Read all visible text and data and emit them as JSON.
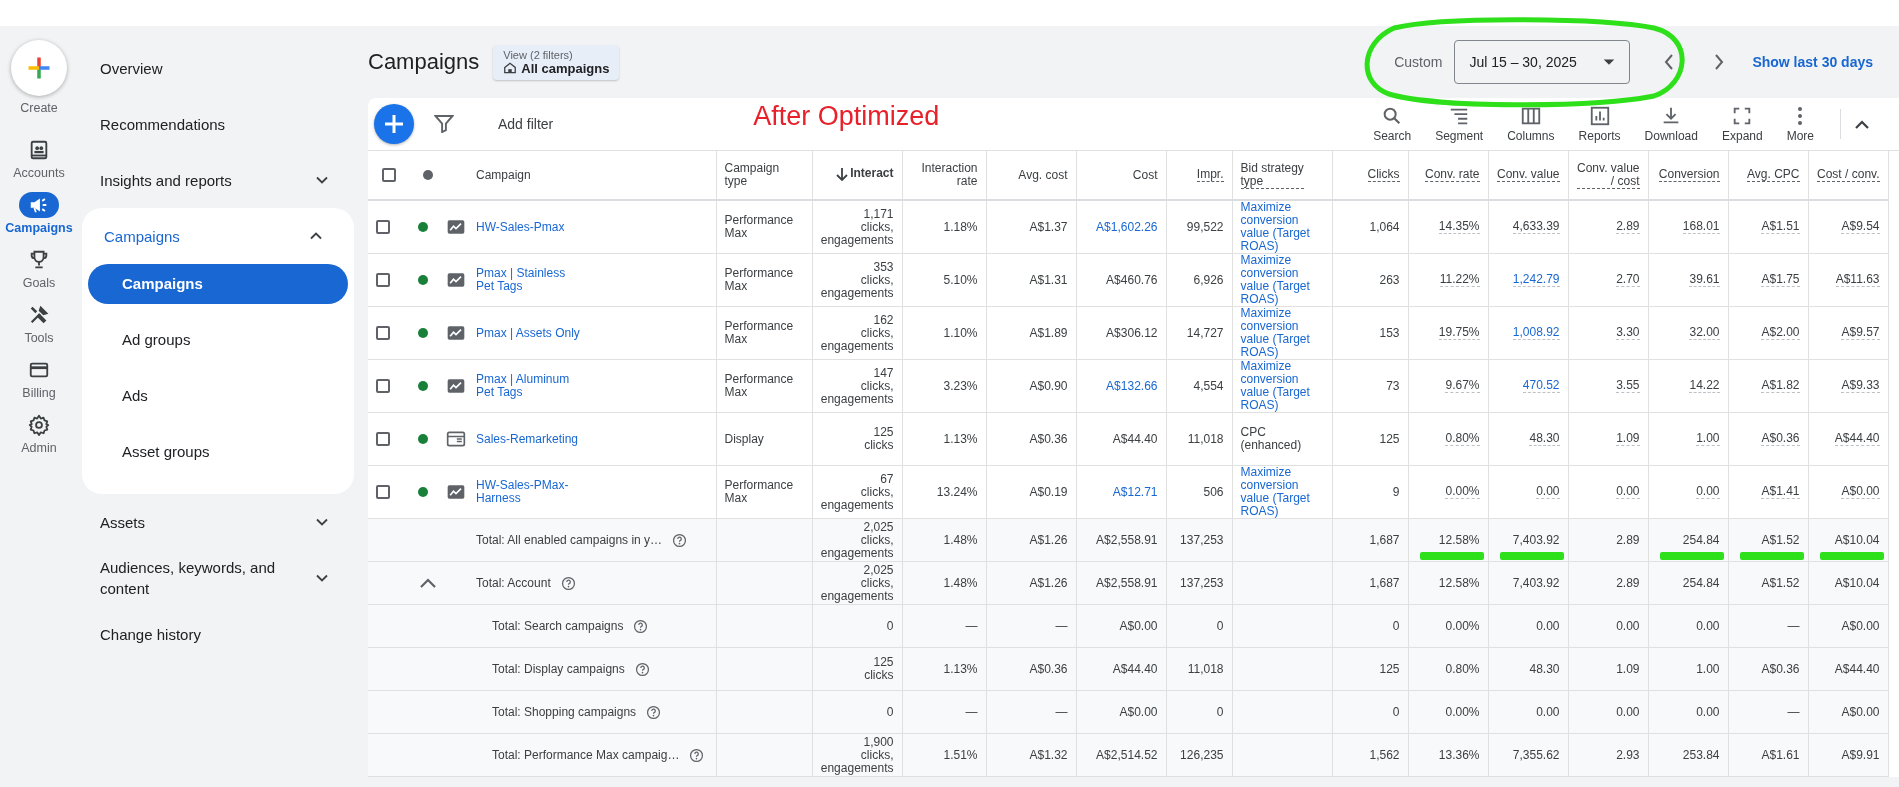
{
  "rail": [
    {
      "label": "Create",
      "kind": "create",
      "selected": false
    },
    {
      "label": "Accounts",
      "kind": "accounts",
      "selected": false
    },
    {
      "label": "Campaigns",
      "kind": "campaigns",
      "selected": true
    },
    {
      "label": "Goals",
      "kind": "goals",
      "selected": false
    },
    {
      "label": "Tools",
      "kind": "tools",
      "selected": false
    },
    {
      "label": "Billing",
      "kind": "billing",
      "selected": false
    },
    {
      "label": "Admin",
      "kind": "admin",
      "selected": false
    }
  ],
  "nav": [
    {
      "label": "Overview"
    },
    {
      "label": "Recommendations"
    },
    {
      "label": "Insights and reports",
      "expanded": false
    },
    {
      "label": "Campaigns",
      "expanded": true,
      "children": [
        {
          "label": "Campaigns",
          "selected": true
        },
        {
          "label": "Ad groups",
          "selected": false
        },
        {
          "label": "Ads",
          "selected": false
        },
        {
          "label": "Asset groups",
          "selected": false
        }
      ]
    },
    {
      "label": "Assets",
      "expanded": false
    },
    {
      "label": "Audiences, keywords, and content",
      "expanded": false
    },
    {
      "label": "Change history"
    }
  ],
  "header": {
    "title": "Campaigns",
    "view": {
      "label": "View (2 filters)",
      "value": "All campaigns"
    },
    "date": {
      "label": "Custom",
      "value": "Jul 15 – 30, 2025"
    },
    "show_last": "Show last 30 days"
  },
  "annotation": "After Optimized",
  "toolbar": {
    "add_filter": "Add filter",
    "tools": [
      {
        "label": "Search",
        "kind": "search"
      },
      {
        "label": "Segment",
        "kind": "segment"
      },
      {
        "label": "Columns",
        "kind": "columns"
      },
      {
        "label": "Reports",
        "kind": "reports"
      },
      {
        "label": "Download",
        "kind": "download"
      },
      {
        "label": "Expand",
        "kind": "expand"
      },
      {
        "label": "More",
        "kind": "more"
      }
    ]
  },
  "table": {
    "all_checked": false,
    "columns": [
      {
        "label": "Campaign",
        "kind": "campaign",
        "sorted": false
      },
      {
        "label": "Campaign\ntype",
        "kind": "text",
        "sorted": false
      },
      {
        "label": "Interact",
        "kind": "number",
        "sorted": true
      },
      {
        "label": "Interaction\nrate",
        "kind": "number",
        "sorted": false
      },
      {
        "label": "Avg. cost",
        "kind": "number",
        "sorted": false
      },
      {
        "label": "Cost",
        "kind": "number",
        "sorted": false
      },
      {
        "label": "Impr.",
        "kind": "number",
        "sorted": false,
        "dotted": true
      },
      {
        "label": "Bid strategy\ntype",
        "kind": "text",
        "sorted": false,
        "dotted": true
      },
      {
        "label": "Clicks",
        "kind": "number",
        "sorted": false,
        "dotted": true
      },
      {
        "label": "Conv. rate",
        "kind": "number",
        "sorted": false,
        "dotted": true,
        "dotted_values": true
      },
      {
        "label": "Conv. value",
        "kind": "number",
        "sorted": false,
        "dotted": true,
        "dotted_values": true
      },
      {
        "label": "Conv. value\n/ cost",
        "kind": "number",
        "sorted": false,
        "dotted": true,
        "dotted_values": true
      },
      {
        "label": "Conversion",
        "kind": "number",
        "sorted": false,
        "dotted": true,
        "dotted_values": true
      },
      {
        "label": "Avg. CPC",
        "kind": "number",
        "sorted": false,
        "dotted": true,
        "dotted_values": true
      },
      {
        "label": "Cost / conv.",
        "kind": "number",
        "sorted": false,
        "dotted": true,
        "dotted_values": true
      }
    ],
    "rows": [
      {
        "checked": false,
        "color": "#188038",
        "kind": "pmax",
        "cells": [
          {
            "text": "HW-Sales-Pmax",
            "link": true
          },
          "Performance\nMax",
          "1,171\nclicks,\nengagements",
          "1.18%",
          "A$1.37",
          {
            "text": "A$1,602.26",
            "link": true
          },
          "99,522",
          {
            "text": "Maximize\nconversion\nvalue (Target\nROAS)",
            "link": true
          },
          "1,064",
          "14.35%",
          "4,633.39",
          "2.89",
          "168.01",
          "A$1.51",
          "A$9.54"
        ]
      },
      {
        "checked": false,
        "color": "#188038",
        "kind": "pmax",
        "cells": [
          {
            "text": "Pmax | Stainless\nPet Tags",
            "link": true
          },
          "Performance\nMax",
          "353\nclicks,\nengagements",
          "5.10%",
          "A$1.31",
          "A$460.76",
          "6,926",
          {
            "text": "Maximize\nconversion\nvalue (Target\nROAS)",
            "link": true
          },
          "263",
          "11.22%",
          {
            "text": "1,242.79",
            "link": true
          },
          "2.70",
          "39.61",
          "A$1.75",
          "A$11.63"
        ]
      },
      {
        "checked": false,
        "color": "#188038",
        "kind": "pmax",
        "cells": [
          {
            "text": "Pmax | Assets Only",
            "link": true
          },
          "Performance\nMax",
          "162\nclicks,\nengagements",
          "1.10%",
          "A$1.89",
          "A$306.12",
          "14,727",
          {
            "text": "Maximize\nconversion\nvalue (Target\nROAS)",
            "link": true
          },
          "153",
          "19.75%",
          {
            "text": "1,008.92",
            "link": true
          },
          "3.30",
          "32.00",
          "A$2.00",
          "A$9.57"
        ]
      },
      {
        "checked": false,
        "color": "#188038",
        "kind": "pmax",
        "cells": [
          {
            "text": "Pmax | Aluminum\nPet Tags",
            "link": true
          },
          "Performance\nMax",
          "147\nclicks,\nengagements",
          "3.23%",
          "A$0.90",
          {
            "text": "A$132.66",
            "link": true
          },
          "4,554",
          {
            "text": "Maximize\nconversion\nvalue (Target\nROAS)",
            "link": true
          },
          "73",
          "9.67%",
          {
            "text": "470.52",
            "link": true
          },
          "3.55",
          "14.22",
          "A$1.82",
          "A$9.33"
        ]
      },
      {
        "checked": false,
        "color": "#188038",
        "kind": "display",
        "cells": [
          {
            "text": "Sales-Remarketing",
            "link": true
          },
          "Display",
          "125\nclicks",
          "1.13%",
          "A$0.36",
          "A$44.40",
          "11,018",
          "CPC (enhanced)",
          "125",
          "0.80%",
          "48.30",
          "1.09",
          "1.00",
          "A$0.36",
          "A$44.40"
        ]
      },
      {
        "checked": false,
        "color": "#188038",
        "kind": "pmax",
        "cells": [
          {
            "text": "HW-Sales-PMax-\nHarness",
            "link": true
          },
          "Performance\nMax",
          "67\nclicks,\nengagements",
          "13.24%",
          "A$0.19",
          {
            "text": "A$12.71",
            "link": true
          },
          "506",
          {
            "text": "Maximize\nconversion\nvalue (Target\nROAS)",
            "link": true
          },
          "9",
          "0.00%",
          "0.00",
          "0.00",
          "0.00",
          "A$1.41",
          "A$0.00"
        ]
      }
    ],
    "totals": [
      {
        "label": "Total: All enabled campaigns in y…",
        "cells": [
          "2,025\nclicks,\nengagements",
          "1.48%",
          "A$1.26",
          "A$2,558.91",
          "137,253",
          "",
          "1,687",
          {
            "text": "12.58%",
            "marked": true
          },
          {
            "text": "7,403.92",
            "marked": true
          },
          "2.89",
          {
            "text": "254.84",
            "marked": true
          },
          {
            "text": "A$1.52",
            "marked": true
          },
          {
            "text": "A$10.04",
            "marked": true
          }
        ]
      },
      {
        "label": "Total: Account",
        "expanded": true,
        "cells": [
          "2,025\nclicks,\nengagements",
          "1.48%",
          "A$1.26",
          "A$2,558.91",
          "137,253",
          "",
          "1,687",
          "12.58%",
          "7,403.92",
          "2.89",
          "254.84",
          "A$1.52",
          "A$10.04"
        ],
        "children": [
          {
            "label": "Total: Search campaigns",
            "cells": [
              "0",
              "—",
              "—",
              "A$0.00",
              "0",
              "",
              "0",
              "0.00%",
              "0.00",
              "0.00",
              "0.00",
              "—",
              "A$0.00"
            ]
          },
          {
            "label": "Total: Display campaigns",
            "cells": [
              "125\nclicks",
              "1.13%",
              "A$0.36",
              "A$44.40",
              "11,018",
              "",
              "125",
              "0.80%",
              "48.30",
              "1.09",
              "1.00",
              "A$0.36",
              "A$44.40"
            ]
          },
          {
            "label": "Total: Shopping campaigns",
            "cells": [
              "0",
              "—",
              "—",
              "A$0.00",
              "0",
              "",
              "0",
              "0.00%",
              "0.00",
              "0.00",
              "0.00",
              "—",
              "A$0.00"
            ]
          },
          {
            "label": "Total: Performance Max campaig…",
            "cells": [
              "1,900\nclicks,\nengagements",
              "1.51%",
              "A$1.32",
              "A$2,514.52",
              "126,235",
              "",
              "1,562",
              "13.36%",
              "7,355.62",
              "2.93",
              "253.84",
              "A$1.61",
              "A$9.91"
            ]
          }
        ]
      }
    ]
  }
}
